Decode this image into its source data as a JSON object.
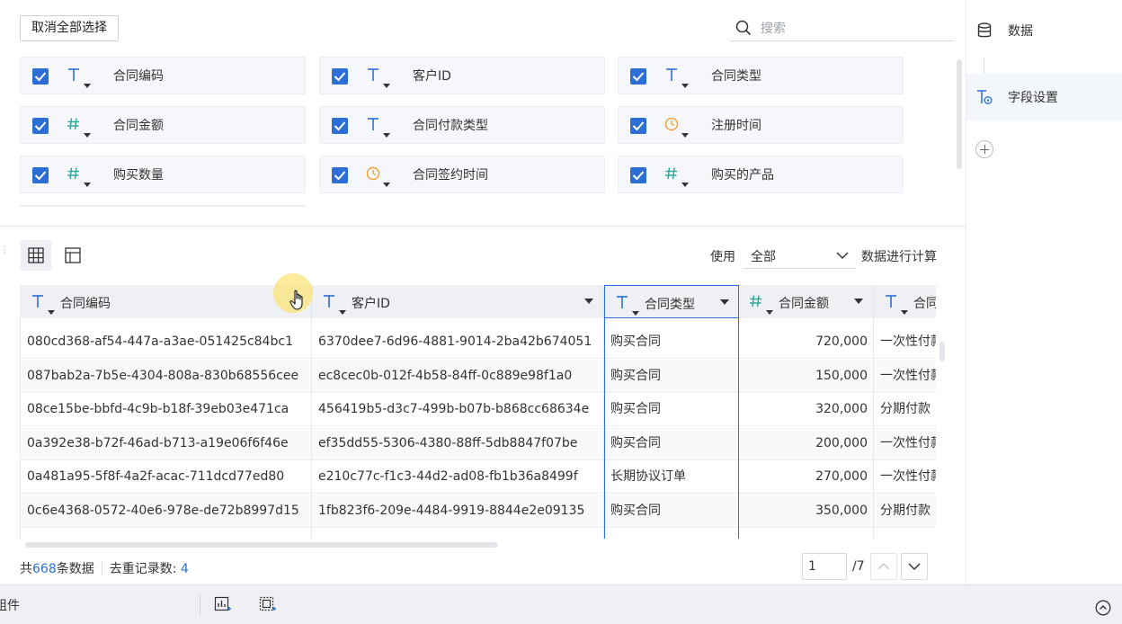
{
  "top": {
    "deselect_all_label": "取消全部选择",
    "search_placeholder": "搜索"
  },
  "fields": [
    {
      "name": "合同编码",
      "type": "text",
      "checked": true
    },
    {
      "name": "客户ID",
      "type": "text",
      "checked": true
    },
    {
      "name": "合同类型",
      "type": "text",
      "checked": true
    },
    {
      "name": "合同金额",
      "type": "number",
      "checked": true
    },
    {
      "name": "合同付款类型",
      "type": "text",
      "checked": true
    },
    {
      "name": "注册时间",
      "type": "date",
      "checked": true
    },
    {
      "name": "购买数量",
      "type": "number",
      "checked": true
    },
    {
      "name": "合同签约时间",
      "type": "date",
      "checked": true
    },
    {
      "name": "购买的产品",
      "type": "number",
      "checked": true
    }
  ],
  "right_panel": {
    "data_label": "数据",
    "field_settings_label": "字段设置"
  },
  "preview": {
    "use_label": "使用",
    "use_value": "全部",
    "use_suffix": "数据进行计算"
  },
  "table": {
    "columns": [
      {
        "label": "合同编码",
        "type": "text"
      },
      {
        "label": "客户ID",
        "type": "text"
      },
      {
        "label": "合同类型",
        "type": "text",
        "selected": true
      },
      {
        "label": "合同金额",
        "type": "number"
      },
      {
        "label": "合同",
        "type": "text"
      }
    ],
    "rows": [
      [
        "080cd368-af54-447a-a3ae-051425c84bc1",
        "6370dee7-6d96-4881-9014-2ba42b674051",
        "购买合同",
        "720,000",
        "一次性付款"
      ],
      [
        "087bab2a-7b5e-4304-808a-830b68556cee",
        "ec8cec0b-012f-4b58-84ff-0c889e98f1a0",
        "购买合同",
        "150,000",
        "一次性付款"
      ],
      [
        "08ce15be-bbfd-4c9b-b18f-39eb03e471ca",
        "456419b5-d3c7-499b-b07b-b868cc68634e",
        "购买合同",
        "320,000",
        "分期付款"
      ],
      [
        "0a392e38-b72f-46ad-b713-a19e06f6f46e",
        "ef35dd55-5306-4380-88ff-5db8847f07be",
        "购买合同",
        "200,000",
        "一次性付款"
      ],
      [
        "0a481a95-5f8f-4a2f-acac-711dcd77ed80",
        "e210c77c-f1c3-44d2-ad08-fb1b36a8499f",
        "长期协议订单",
        "270,000",
        "一次性付款"
      ],
      [
        "0c6e4368-0572-40e6-978e-de72b8997d15",
        "1fb823f6-209e-4484-9919-8844e2e09135",
        "购买合同",
        "350,000",
        "分期付款"
      ]
    ]
  },
  "footer": {
    "total_prefix": "共",
    "total_count": "668",
    "total_suffix": "条数据",
    "dedup_label": "去重记录数:",
    "dedup_count": "4",
    "page_current": "1",
    "page_total": "/7"
  },
  "bottom_bar": {
    "left_text": "组件"
  },
  "colors": {
    "accent": "#2b6fd6",
    "date_icon": "#f0a23a",
    "number_icon": "#2aa89a",
    "text_icon": "#2b6fd6"
  }
}
